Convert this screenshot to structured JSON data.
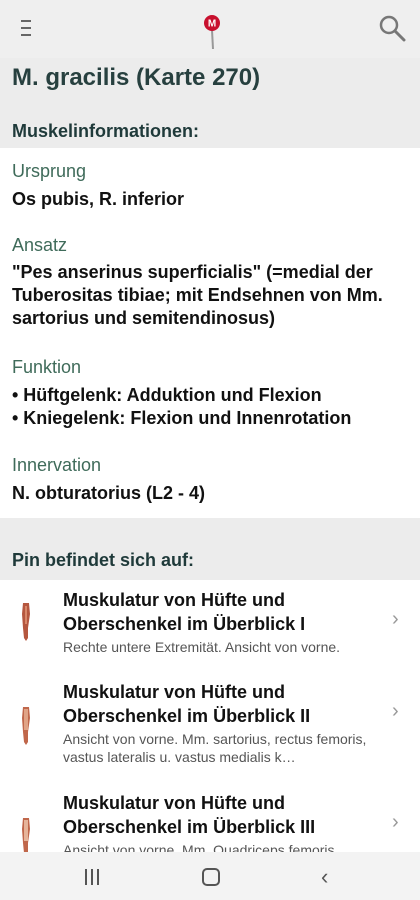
{
  "header": {
    "menu_icon": "hamburger-menu-icon",
    "logo_icon": "map-pin-logo-icon",
    "logo_letter": "M",
    "search_icon": "search-icon",
    "brand_color": "#c8102e"
  },
  "page": {
    "title": "M. gracilis (Karte 270)"
  },
  "muscle_info": {
    "section_title": "Muskelinformationen:",
    "origin_label": "Ursprung",
    "origin_value": "Os pubis, R. inferior",
    "insertion_label": "Ansatz",
    "insertion_value": "\"Pes anserinus superficialis\" (=medial der Tuberositas tibiae; mit Endsehnen von Mm. sartorius und semitendinosus)",
    "function_label": "Funktion",
    "function_items": [
      "• Hüftgelenk: Adduktion und Flexion",
      "• Kniegelenk: Flexion und Innenrotation"
    ],
    "innervation_label": "Innervation",
    "innervation_value": "N. obturatorius (L2 - 4)"
  },
  "pin_location": {
    "section_title": "Pin befindet sich auf:",
    "items": [
      {
        "title": "Muskulatur von Hüfte und Oberschenkel im Überblick I",
        "subtitle": "Rechte untere Extremität. Ansicht von vorne."
      },
      {
        "title": "Muskulatur von Hüfte und Oberschenkel im Überblick II",
        "subtitle": "Ansicht von vorne. Mm. sartorius, rectus femoris, vastus lateralis u. vastus medialis k…"
      },
      {
        "title": "Muskulatur von Hüfte und Oberschenkel im Überblick III",
        "subtitle": "Ansicht von vorne. Mm. Quadriceps femoris…"
      }
    ],
    "chevron": "›"
  },
  "navbar": {
    "recents_icon": "recents-icon",
    "home_icon": "home-icon",
    "back_icon": "back-icon",
    "back_glyph": "‹"
  }
}
